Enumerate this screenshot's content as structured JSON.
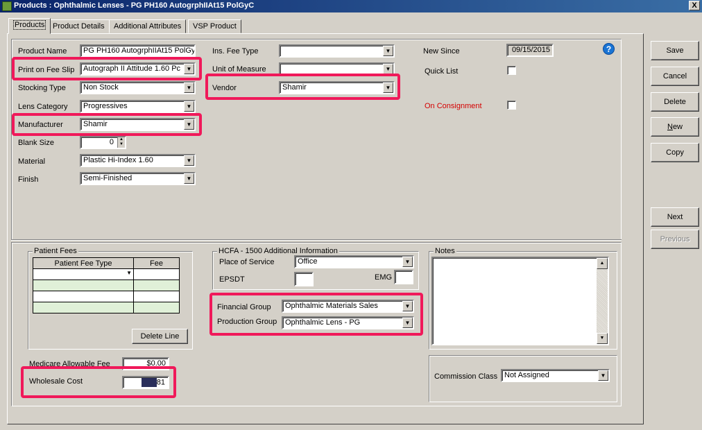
{
  "window": {
    "title": "Products : Ophthalmic Lenses - PG PH160 AutogrphIIAt15 PolGyC",
    "close_label": "X"
  },
  "tabs": [
    "Products",
    "Product Details",
    "Additional Attributes",
    "VSP Product"
  ],
  "left_fields": {
    "product_name": {
      "label": "Product Name",
      "value": "PG PH160 AutogrphIIAt15 PolGyC"
    },
    "print_on_fee_slip": {
      "label": "Print on Fee Slip",
      "value": "Autograph II Attitude 1.60 Pc"
    },
    "stocking_type": {
      "label": "Stocking Type",
      "value": "Non Stock"
    },
    "lens_category": {
      "label": "Lens Category",
      "value": "Progressives"
    },
    "manufacturer": {
      "label": "Manufacturer",
      "value": "Shamir"
    },
    "blank_size": {
      "label": "Blank Size",
      "value": "0"
    },
    "material": {
      "label": "Material",
      "value": "Plastic Hi-Index 1.60"
    },
    "finish": {
      "label": "Finish",
      "value": "Semi-Finished"
    }
  },
  "mid_fields": {
    "ins_fee_type": {
      "label": "Ins. Fee Type",
      "value": ""
    },
    "unit_of_measure": {
      "label": "Unit of Measure",
      "value": ""
    },
    "vendor": {
      "label": "Vendor",
      "value": "Shamir"
    }
  },
  "right_fields": {
    "new_since": {
      "label": "New Since",
      "value": "09/15/2015"
    },
    "quick_list": {
      "label": "Quick List",
      "checked": false
    },
    "on_consignment": {
      "label": "On Consignment",
      "checked": false
    }
  },
  "help_icon": "?",
  "patient_fees": {
    "title": "Patient Fees",
    "columns": [
      "Patient Fee Type",
      "Fee"
    ],
    "delete_line_label": "Delete Line"
  },
  "medicare": {
    "label": "Medicare Allowable Fee",
    "value": "$0.00"
  },
  "wholesale": {
    "label": "Wholesale Cost",
    "value_suffix": "81"
  },
  "hcfa": {
    "title": "HCFA - 1500 Additional Information",
    "place_of_service": {
      "label": "Place of Service",
      "value": "Office"
    },
    "epsdt": {
      "label": "EPSDT",
      "value": ""
    },
    "emg": {
      "label": "EMG",
      "value": ""
    }
  },
  "groups": {
    "financial": {
      "label": "Financial Group",
      "value": "Ophthalmic Materials Sales"
    },
    "production": {
      "label": "Production Group",
      "value": "Ophthalmic Lens - PG"
    }
  },
  "notes": {
    "title": "Notes"
  },
  "commission": {
    "label": "Commission Class",
    "value": "Not Assigned"
  },
  "buttons": {
    "save": "Save",
    "cancel": "Cancel",
    "delete": "Delete",
    "new": "New",
    "copy": "Copy",
    "next": "Next",
    "previous": "Previous"
  },
  "colors": {
    "highlight": "#f0195a",
    "titlebar": "#0a246a",
    "window_bg": "#d4d0c8"
  }
}
